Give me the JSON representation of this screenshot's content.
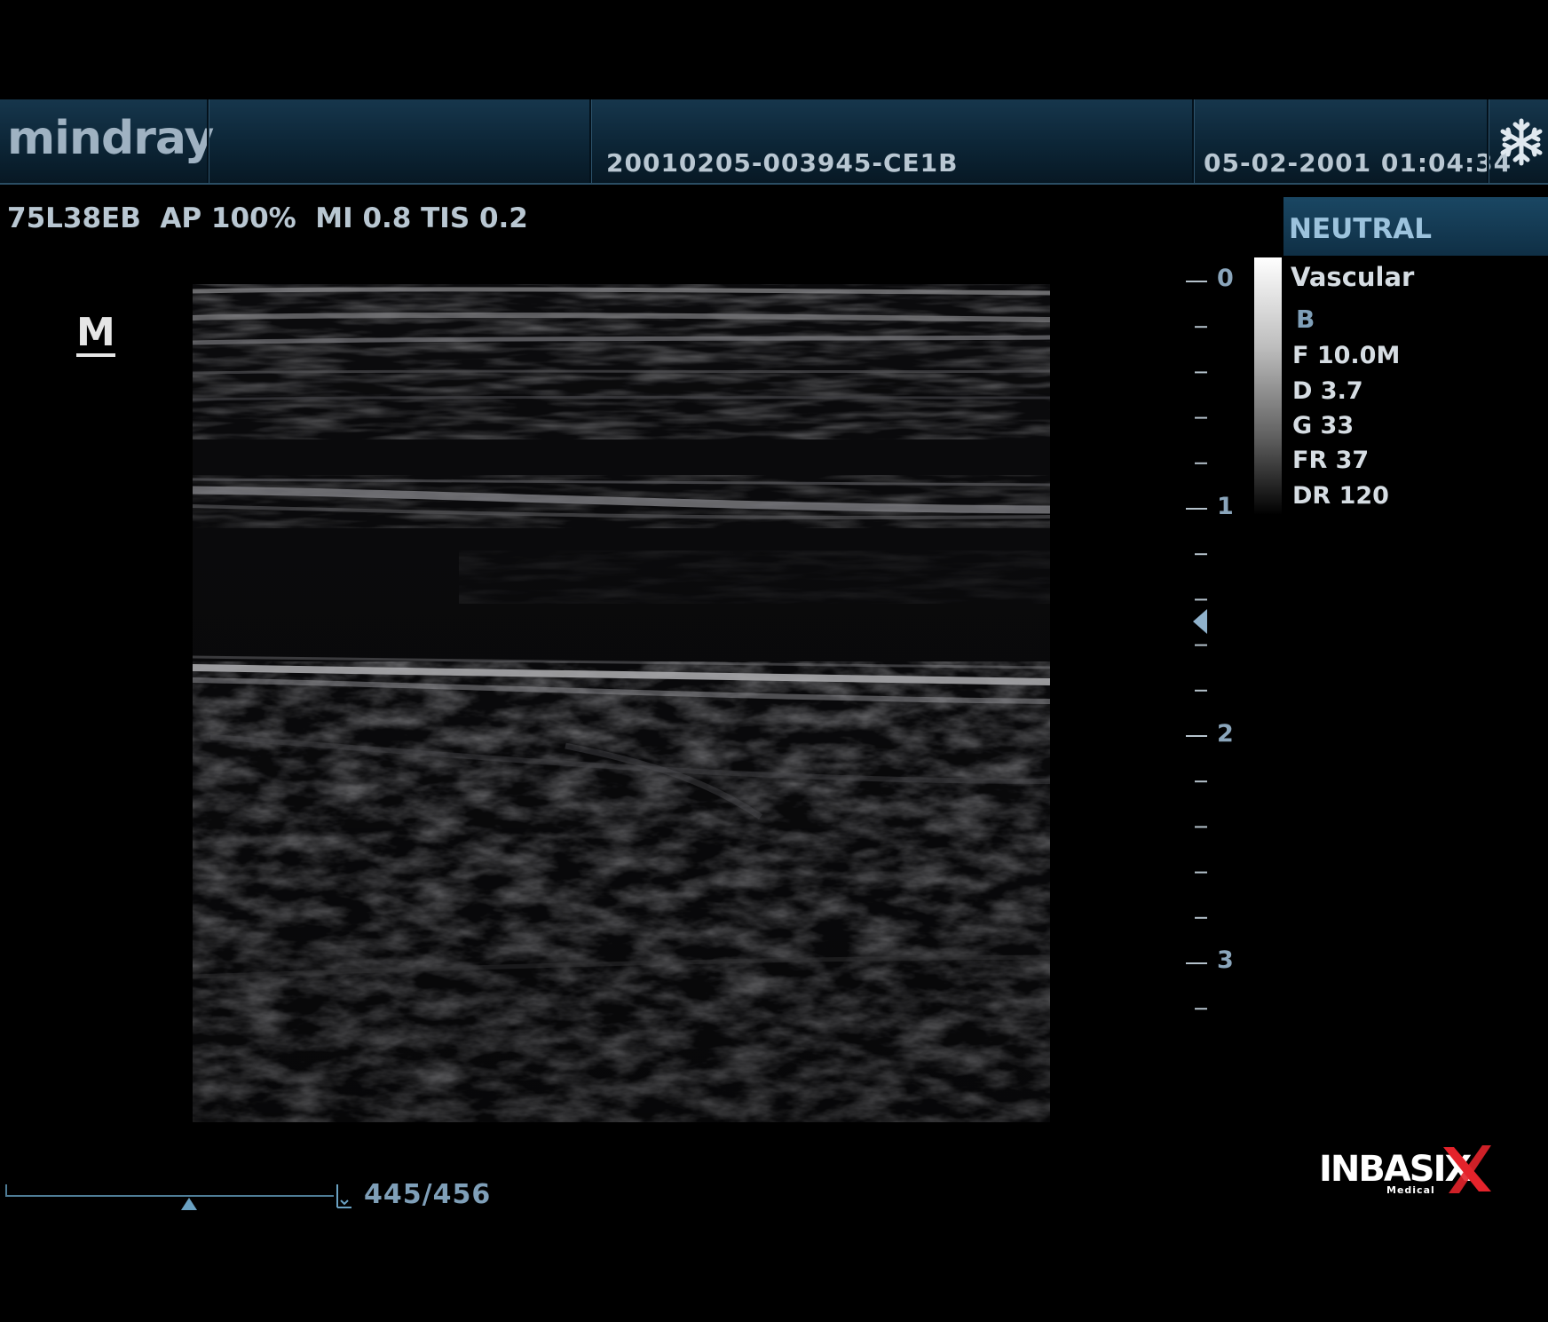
{
  "header": {
    "brand_logo": "mindray",
    "study_id": "20010205-003945-CE1B",
    "datetime": "05-02-2001 01:04:34",
    "freeze_icon": "snowflake-icon"
  },
  "imaging_params": {
    "line": "75L38EB  AP 100%  MI 0.8 TIS 0.2"
  },
  "side_panel": {
    "mode_label": "NEUTRAL",
    "preset": "Vascular",
    "mode": "B",
    "params": [
      "F 10.0M",
      "D 3.7",
      "G 33",
      "FR 37",
      "DR 120"
    ]
  },
  "image_marker": "M",
  "depth_scale": {
    "labels": [
      "0",
      "1",
      "2",
      "3"
    ],
    "focus_indicator": "focus-arrow-icon"
  },
  "cine": {
    "frame_counter": "445/456",
    "position_fraction": 0.56
  },
  "watermark": {
    "brand": "INBASIX",
    "sub": "Medical"
  },
  "colors": {
    "header_bg": "#0c2536",
    "accent": "#7f9fb8",
    "text": "#b9c7d2"
  }
}
